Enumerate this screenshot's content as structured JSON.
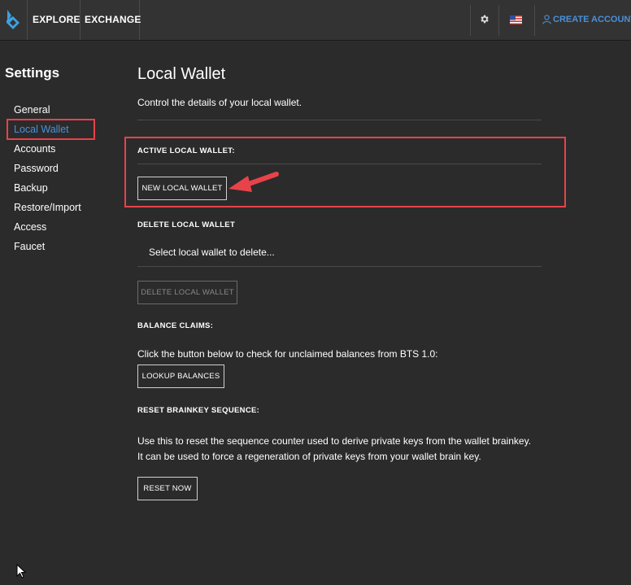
{
  "topbar": {
    "nav": [
      "EXPLORE",
      "EXCHANGE"
    ],
    "create_account": "CREATE ACCOUNT",
    "icons": {
      "logo": "bitshares-logo-icon",
      "settings": "gear-icon",
      "language": "us-flag-icon",
      "user": "user-icon"
    }
  },
  "sidebar": {
    "title": "Settings",
    "items": [
      "General",
      "Local Wallet",
      "Accounts",
      "Password",
      "Backup",
      "Restore/Import",
      "Access",
      "Faucet"
    ],
    "active": "Local Wallet"
  },
  "main": {
    "title": "Local Wallet",
    "description": "Control the details of your local wallet.",
    "active_wallet": {
      "label": "ACTIVE LOCAL WALLET:",
      "button": "NEW LOCAL WALLET"
    },
    "delete_wallet": {
      "label": "DELETE LOCAL WALLET",
      "placeholder": "Select local wallet to delete...",
      "button": "DELETE LOCAL WALLET"
    },
    "balance_claims": {
      "label": "BALANCE CLAIMS:",
      "text": "Click the button below to check for unclaimed balances from BTS 1.0:",
      "button": "LOOKUP BALANCES"
    },
    "brainkey": {
      "label": "RESET BRAINKEY SEQUENCE:",
      "text_line1": "Use this to reset the sequence counter used to derive private keys from the wallet brainkey.",
      "text_line2": "It can be used to force a regeneration of private keys from your wallet brain key.",
      "button": "RESET NOW"
    }
  },
  "colors": {
    "background": "#2b2b2b",
    "topbar": "#333333",
    "accent": "#4a90d9",
    "highlight": "#e8424a"
  }
}
